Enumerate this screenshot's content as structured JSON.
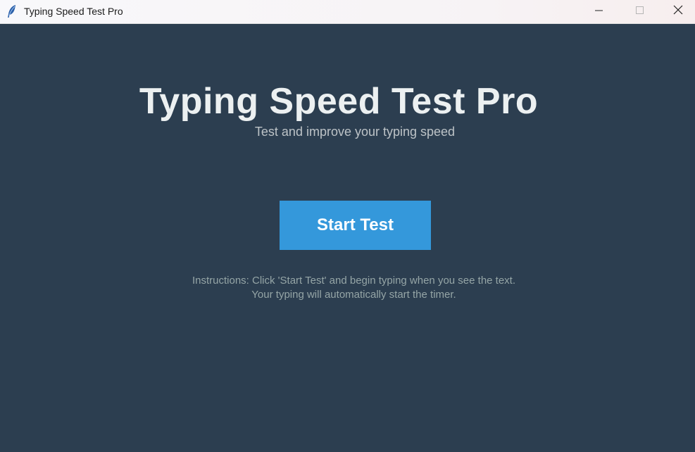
{
  "window": {
    "title": "Typing Speed Test Pro",
    "icon": "feather-icon",
    "controls": [
      "minimize-icon",
      "maximize-icon",
      "close-icon"
    ]
  },
  "main": {
    "title": "Typing Speed Test Pro",
    "subtitle": "Test and improve your typing speed",
    "start_button_label": "Start Test",
    "instructions": [
      "Instructions: Click 'Start Test' and begin typing when you see the text.",
      "Your typing will automatically start the timer."
    ]
  },
  "colors": {
    "background": "#2c3e50",
    "title": "#ecf0f1",
    "subtitle": "#bdc3c7",
    "button": "#3498db",
    "instructions": "#95a5a6"
  }
}
